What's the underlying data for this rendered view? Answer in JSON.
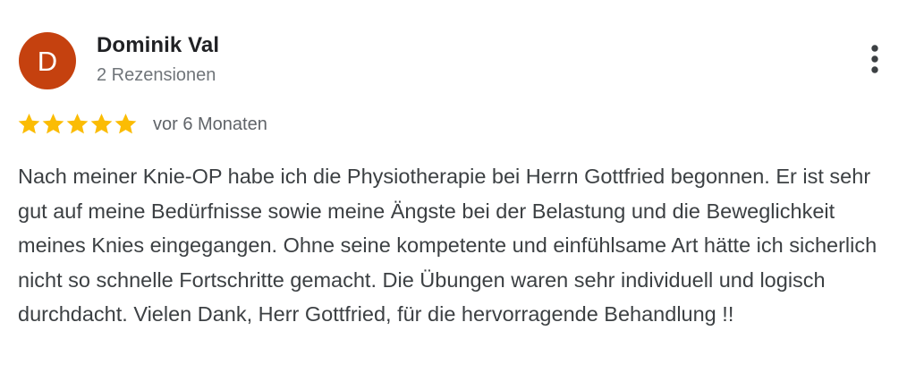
{
  "review": {
    "author": {
      "initial": "D",
      "name": "Dominik Val",
      "reviews_count": "2 Rezensionen",
      "avatar_color": "#c5410f"
    },
    "rating": {
      "stars": 5,
      "max_stars": 5,
      "star_color": "#fbbc04"
    },
    "date": "vor 6 Monaten",
    "text": "Nach meiner Knie-OP habe ich die Physiotherapie bei Herrn Gottfried begonnen. Er ist sehr gut auf meine Bedürfnisse sowie meine Ängste bei der Belastung und die Beweglichkeit meines Knies eingegangen. Ohne seine kompetente und einfühlsame Art hätte ich sicherlich nicht so schnelle Fortschritte gemacht. Die Übungen waren sehr individuell und logisch durchdacht. Vielen Dank, Herr Gottfried, für die hervorragende Behandlung !!",
    "more_icon": "more-vert-icon"
  }
}
